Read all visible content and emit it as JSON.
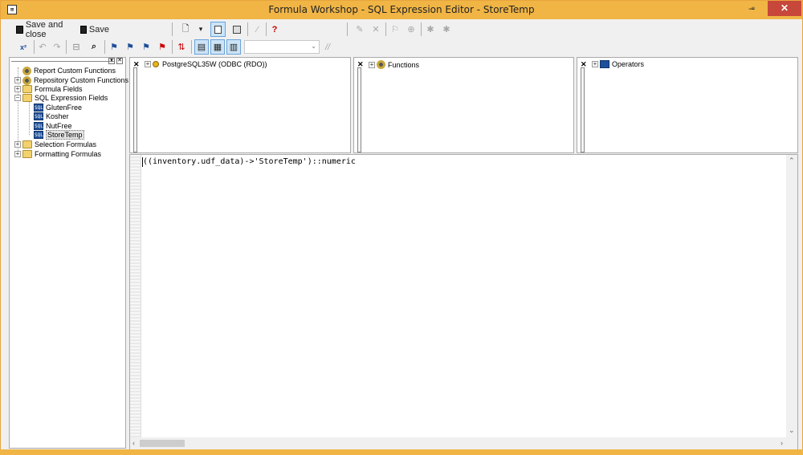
{
  "window": {
    "title": "Formula Workshop - SQL Expression Editor - StoreTemp",
    "app_icon": "⊞",
    "minimize": "–",
    "maximize": "▫",
    "close": "✕"
  },
  "toolbar1": {
    "save_close_label": "Save and close",
    "save_label": "Save",
    "new_glyph": "🗋",
    "new_caret": "▾",
    "help_glyph": "?"
  },
  "toolbar2": {
    "comment_glyph": "//",
    "dropdown_caret": "⌄"
  },
  "tree": {
    "items": [
      {
        "label": "Report Custom Functions"
      },
      {
        "label": "Repository Custom Functions"
      },
      {
        "label": "Formula Fields"
      },
      {
        "label": "SQL Expression Fields"
      },
      {
        "label": "GlutenFree"
      },
      {
        "label": "Kosher"
      },
      {
        "label": "NutFree"
      },
      {
        "label": "StoreTemp"
      },
      {
        "label": "Selection Formulas"
      },
      {
        "label": "Formatting Formulas"
      }
    ]
  },
  "panes": {
    "fields": {
      "label": "PostgreSQL35W (ODBC (RDO))"
    },
    "functions": {
      "label": "Functions"
    },
    "operators": {
      "label": "Operators"
    }
  },
  "editor": {
    "code": "((inventory.udf_data)->'StoreTemp')::numeric"
  },
  "colors": {
    "titlebar": "#f0b545",
    "close_button": "#c7473b",
    "selected_button": "#cce4f7"
  }
}
